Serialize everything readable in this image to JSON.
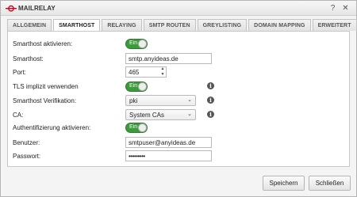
{
  "window": {
    "title": "MAILRELAY"
  },
  "tabs": [
    {
      "label": "ALLGEMEIN"
    },
    {
      "label": "SMARTHOST"
    },
    {
      "label": "RELAYING"
    },
    {
      "label": "SMTP ROUTEN"
    },
    {
      "label": "GREYLISTING"
    },
    {
      "label": "DOMAIN MAPPING"
    },
    {
      "label": "ERWEITERT"
    }
  ],
  "form": {
    "smarthost_active": {
      "label": "Smarthost aktivieren:",
      "toggle": "Ein"
    },
    "smarthost": {
      "label": "Smarthost:",
      "value": "smtp.anyideas.de"
    },
    "port": {
      "label": "Port:",
      "value": "465"
    },
    "tls": {
      "label": "TLS implizit verwenden",
      "toggle": "Ein"
    },
    "verification": {
      "label": "Smarthost Verifikation:",
      "value": "pki"
    },
    "ca": {
      "label": "CA:",
      "value": "System CAs"
    },
    "auth": {
      "label": "Authentifizierung aktivieren:",
      "toggle": "Ein"
    },
    "user": {
      "label": "Benutzer:",
      "value": "smtpuser@anyideas.de"
    },
    "password": {
      "label": "Passwort:",
      "value": "•••••••••"
    }
  },
  "footer": {
    "save_label": "Speichern",
    "close_label": "Schließen"
  },
  "colors": {
    "toggle_on": "#3c9a3c",
    "logo_red": "#d0021b"
  }
}
